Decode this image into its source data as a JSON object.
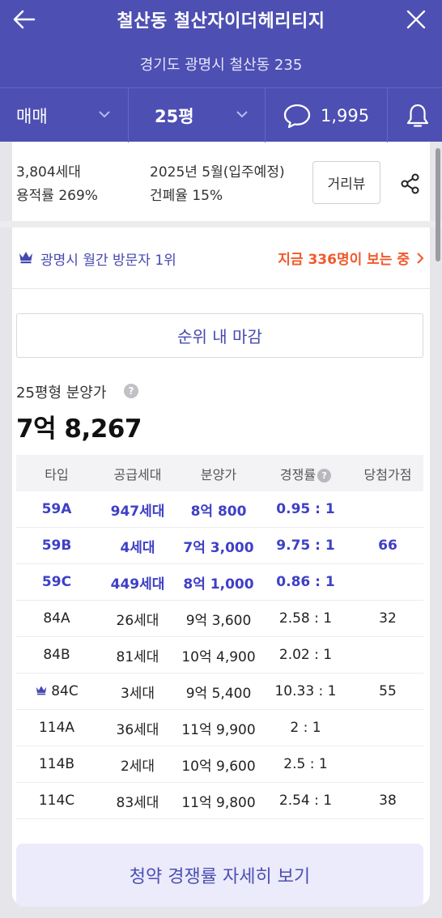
{
  "header": {
    "title": "철산동 철산자이더헤리티지",
    "address": "경기도 광명시 철산동 235",
    "trade_type": "매매",
    "pyeong": "25평",
    "comment_count": "1,995",
    "bg_color": "#4d4fb2"
  },
  "info": {
    "households": "3,804세대",
    "floor_area_ratio": "용적률 269%",
    "move_in": "2025년 5월(입주예정)",
    "building_coverage": "건폐율 15%",
    "distance_view_label": "거리뷰"
  },
  "rank": {
    "text": "광명시 월간 방문자 1위",
    "viewing": "지금 336명이 보는 중"
  },
  "deadline_label": "순위 내 마감",
  "price": {
    "label": "25평형 분양가",
    "value": "7억 8,267"
  },
  "table": {
    "headers": [
      "타입",
      "공급세대",
      "분양가",
      "경쟁률",
      "당첨가점"
    ],
    "rows": [
      {
        "type": "59A",
        "supply": "947세대",
        "price": "8억 800",
        "rate": "0.95 : 1",
        "score": ""
      },
      {
        "type": "59B",
        "supply": "4세대",
        "price": "7억 3,000",
        "rate": "9.75 : 1",
        "score": "66"
      },
      {
        "type": "59C",
        "supply": "449세대",
        "price": "8억 1,000",
        "rate": "0.86 : 1",
        "score": ""
      },
      {
        "type": "84A",
        "supply": "26세대",
        "price": "9억 3,600",
        "rate": "2.58 : 1",
        "score": "32"
      },
      {
        "type": "84B",
        "supply": "81세대",
        "price": "10억 4,900",
        "rate": "2.02 : 1",
        "score": ""
      },
      {
        "type": "84C",
        "supply": "3세대",
        "price": "9억 5,400",
        "rate": "10.33 : 1",
        "score": "55"
      },
      {
        "type": "114A",
        "supply": "36세대",
        "price": "11억 9,900",
        "rate": "2 : 1",
        "score": ""
      },
      {
        "type": "114B",
        "supply": "2세대",
        "price": "10억 9,600",
        "rate": "2.5 : 1",
        "score": ""
      },
      {
        "type": "114C",
        "supply": "83세대",
        "price": "11억 9,800",
        "rate": "2.54 : 1",
        "score": "38"
      }
    ]
  },
  "detail_button_label": "청약 경쟁률 자세히 보기"
}
